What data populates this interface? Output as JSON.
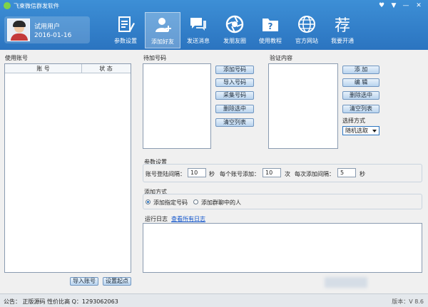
{
  "window": {
    "title": "飞柬微信群发软件",
    "controls": [
      "♥",
      "▼",
      "—",
      "✕"
    ]
  },
  "user": {
    "name": "试用用户",
    "date": "2016-01-16"
  },
  "nav": [
    {
      "label": "参数设置",
      "icon": "clipboard-pencil-icon"
    },
    {
      "label": "添加好友",
      "icon": "add-friend-icon",
      "active": true
    },
    {
      "label": "发送消息",
      "icon": "chat-bubbles-icon"
    },
    {
      "label": "发朋友圈",
      "icon": "camera-aperture-icon"
    },
    {
      "label": "使用教程",
      "icon": "help-folder-icon"
    },
    {
      "label": "官方网站",
      "icon": "globe-icon"
    },
    {
      "label": "我要开通",
      "char": "荐"
    }
  ],
  "accounts": {
    "title": "使用账号",
    "col_account": "账 号",
    "col_status": "状 态",
    "import_btn": "导入账号",
    "start_btn": "设置起点"
  },
  "pending": {
    "title": "待加号码",
    "buttons": [
      "添加号码",
      "导入号码",
      "采集号码",
      "删除选中",
      "清空列表"
    ]
  },
  "verify": {
    "title": "验证内容",
    "buttons": [
      "添 加",
      "编 辑",
      "删除选中",
      "清空列表"
    ],
    "select_label": "选择方式",
    "select_value": "随机选取"
  },
  "params": {
    "title": "参数设置",
    "login_interval_label": "账号登陆间隔：",
    "login_interval_value": "10",
    "login_interval_unit": "秒",
    "per_account_label": "每个账号添加：",
    "per_account_value": "10",
    "per_account_unit": "次",
    "add_interval_label": "每次添加间隔：",
    "add_interval_value": "5",
    "add_interval_unit": "秒"
  },
  "method": {
    "title": "添加方式",
    "opt1": "添加指定号码",
    "opt2": "添加群聊中的人"
  },
  "log": {
    "title": "运行日志",
    "link": "查看所有日志"
  },
  "status": {
    "text": "公告：  正版源码 性价比高 Q：1293062063",
    "version": "版本：V 8.6"
  }
}
